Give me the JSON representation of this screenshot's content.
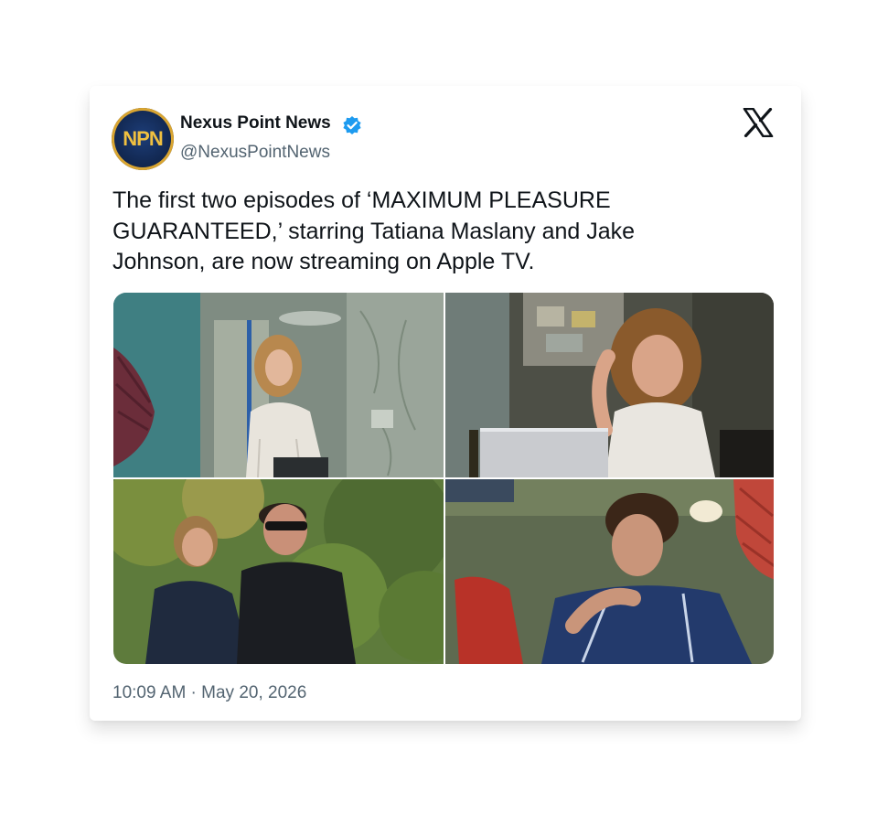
{
  "author": {
    "avatar_text": "NPN",
    "display_name": "Nexus Point News",
    "handle": "@NexusPointNews",
    "verified": true
  },
  "tweet": {
    "text": "The first two episodes of ‘MAXIMUM PLEASURE GUARANTEED,’ starring Tatiana Maslany and Jake Johnson, are now streaming on Apple TV.",
    "timestamp": "10:09 AM · May 20, 2026"
  },
  "media": {
    "photos": [
      {
        "icon": "photo-woman-hockey-stick"
      },
      {
        "icon": "photo-woman-laptop"
      },
      {
        "icon": "photo-couple-outdoors"
      },
      {
        "icon": "photo-young-man-jacket"
      }
    ]
  },
  "colors": {
    "text": "#0f1419",
    "secondary_text": "#536471",
    "verified_badge": "#1d9bf0",
    "avatar_bg": "#132a55",
    "avatar_accent": "#f0c040"
  }
}
